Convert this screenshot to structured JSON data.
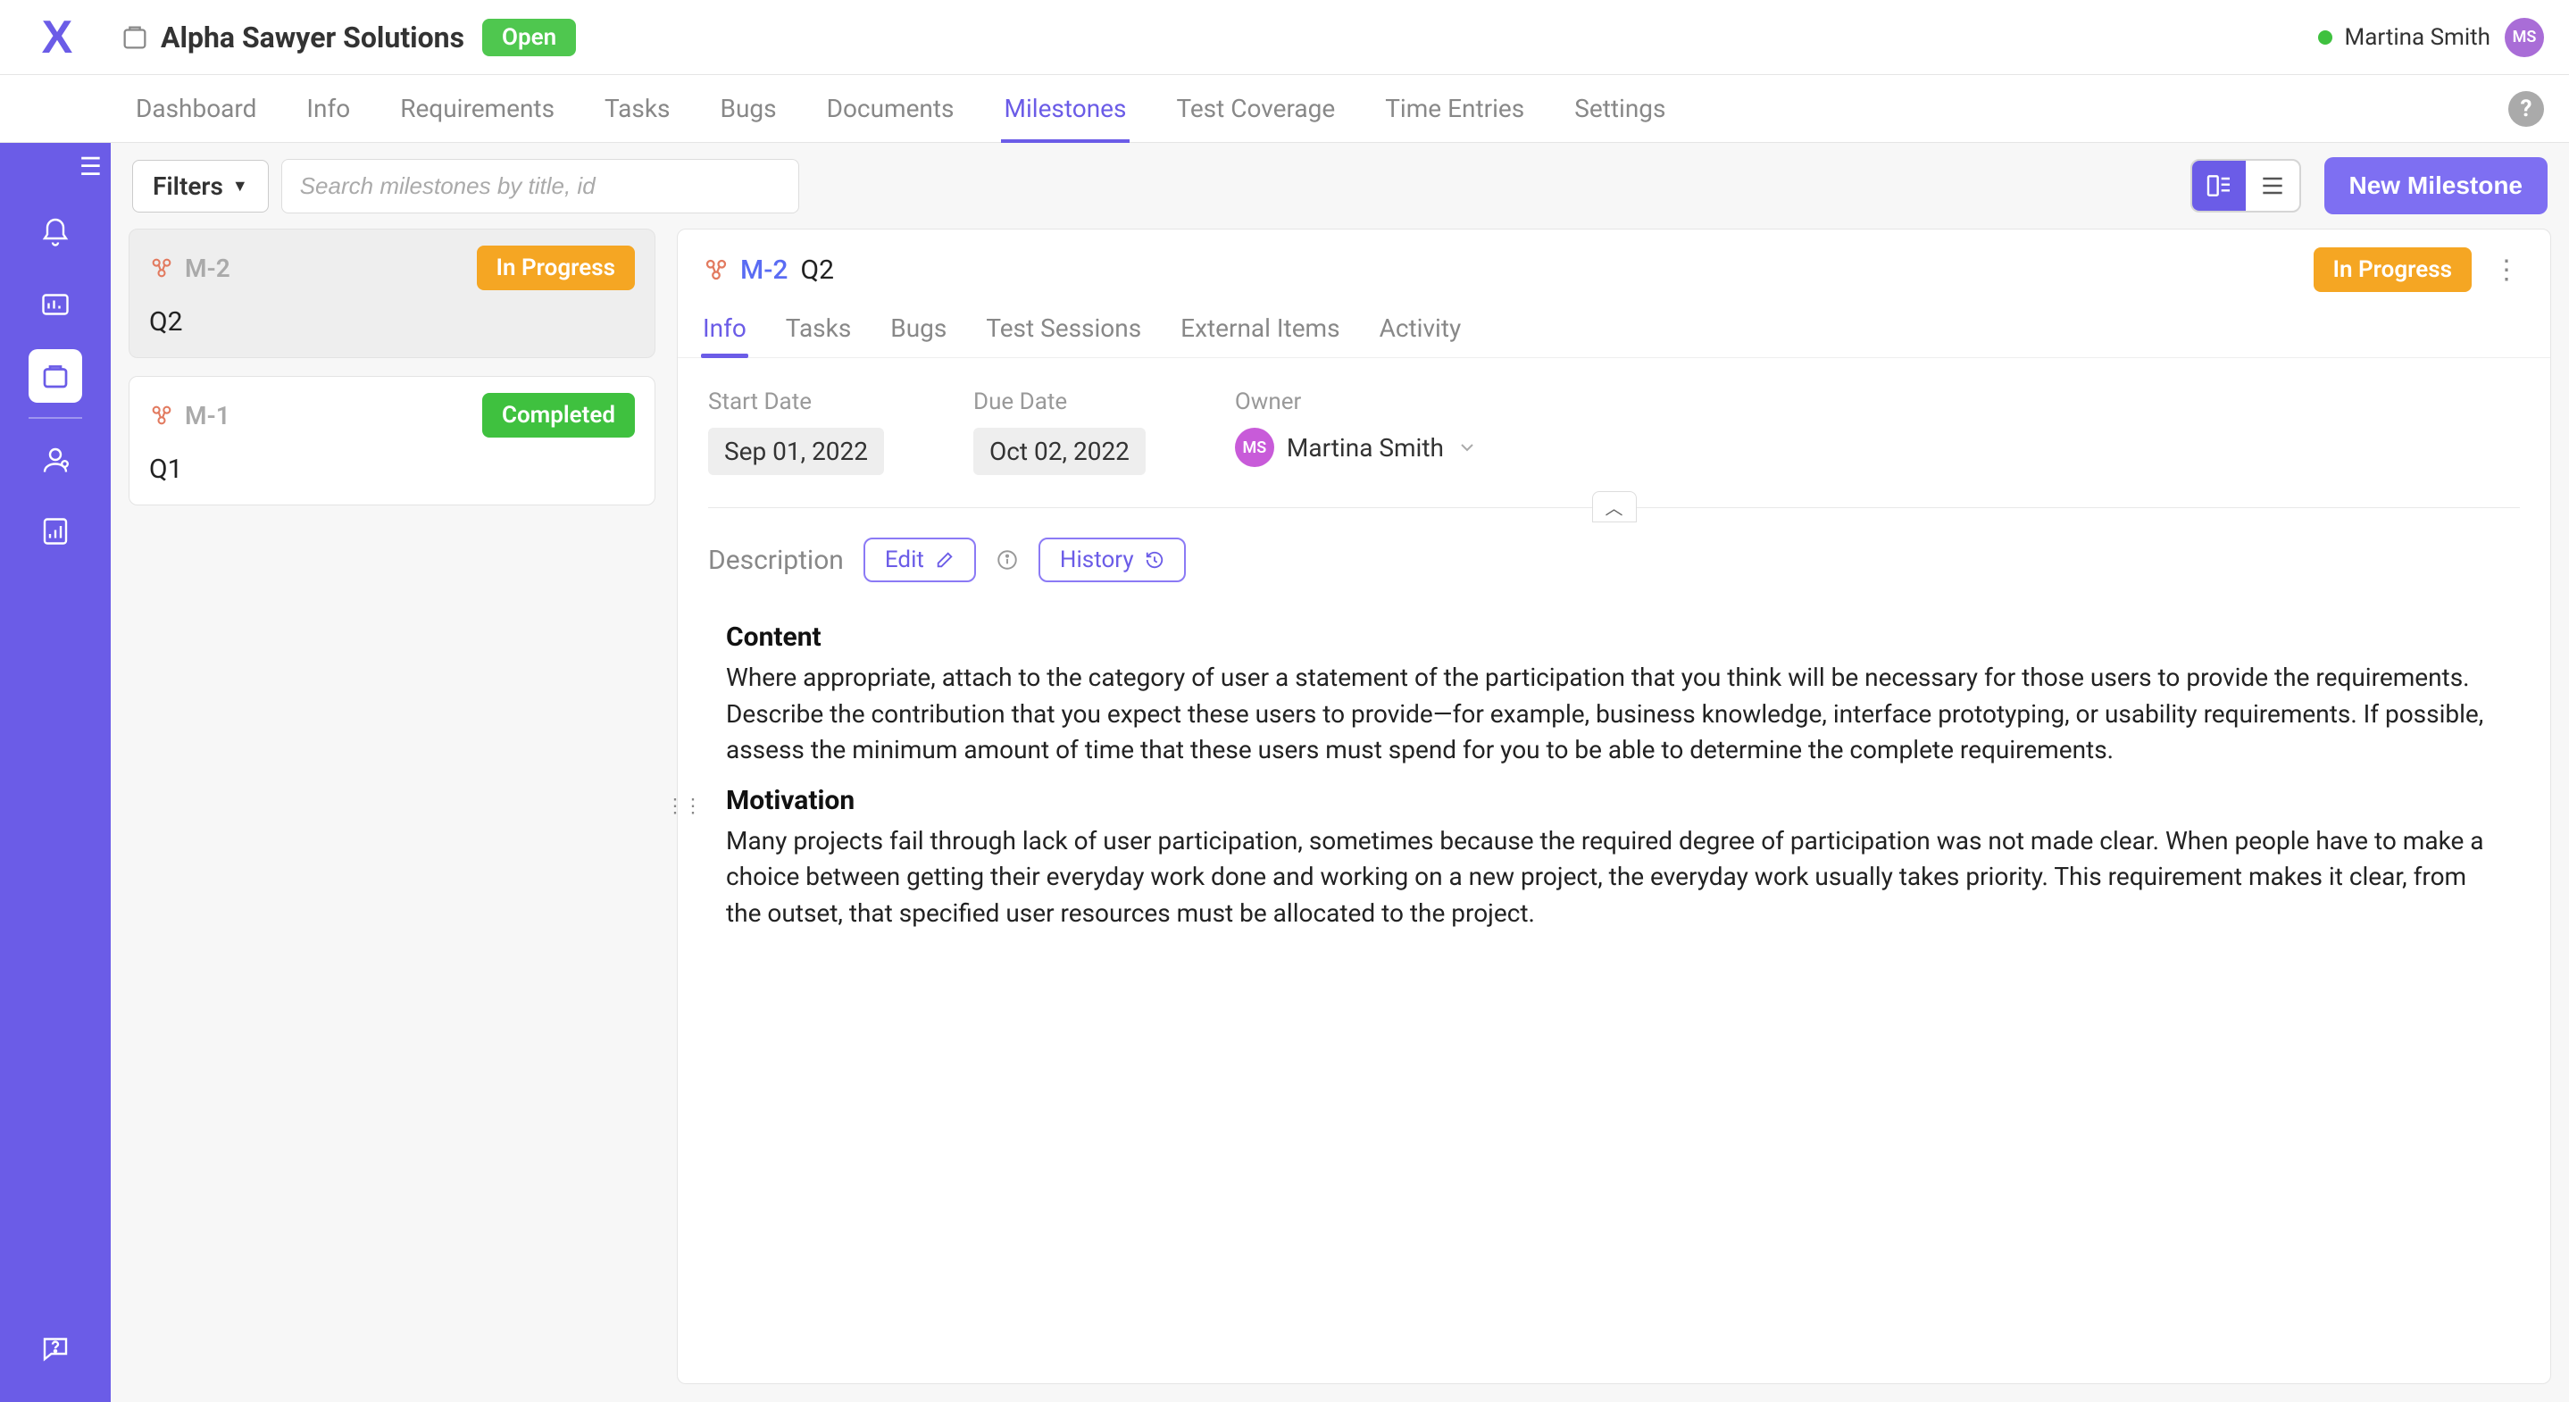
{
  "header": {
    "project_name": "Alpha Sawyer Solutions",
    "project_status": "Open",
    "user_name": "Martina Smith",
    "user_initials": "MS"
  },
  "nav": {
    "items": [
      "Dashboard",
      "Info",
      "Requirements",
      "Tasks",
      "Bugs",
      "Documents",
      "Milestones",
      "Test Coverage",
      "Time Entries",
      "Settings"
    ],
    "active_index": 6
  },
  "toolbar": {
    "filters_label": "Filters",
    "search_placeholder": "Search milestones by title, id",
    "new_button": "New Milestone"
  },
  "milestone_list": [
    {
      "id": "M-2",
      "title": "Q2",
      "status": "In Progress",
      "status_class": "st-progress",
      "selected": true
    },
    {
      "id": "M-1",
      "title": "Q1",
      "status": "Completed",
      "status_class": "st-completed",
      "selected": false
    }
  ],
  "detail": {
    "id": "M-2",
    "title": "Q2",
    "status": "In Progress",
    "tabs": [
      "Info",
      "Tasks",
      "Bugs",
      "Test Sessions",
      "External Items",
      "Activity"
    ],
    "active_tab_index": 0,
    "meta": {
      "start_label": "Start Date",
      "start_value": "Sep 01, 2022",
      "due_label": "Due Date",
      "due_value": "Oct 02, 2022",
      "owner_label": "Owner",
      "owner_name": "Martina Smith",
      "owner_initials": "MS"
    },
    "description": {
      "section_label": "Description",
      "edit_label": "Edit",
      "history_label": "History",
      "heading1": "Content",
      "para1": "Where appropriate, attach to the category of user a statement of the participation that you think will be necessary for those users to provide the requirements. Describe the contribution that you expect these users to provide—for example, business knowledge, interface prototyping, or usability requirements. If possible, assess the minimum amount of time that these users must spend for you to be able to determine the complete requirements.",
      "heading2": "Motivation",
      "para2": "Many projects fail through lack of user participation, sometimes because the required degree of participation was not made clear. When people have to make a choice between getting their everyday work done and working on a new project, the everyday work usually takes priority. This requirement makes it clear, from the outset, that specified user resources must be allocated to the project."
    }
  }
}
